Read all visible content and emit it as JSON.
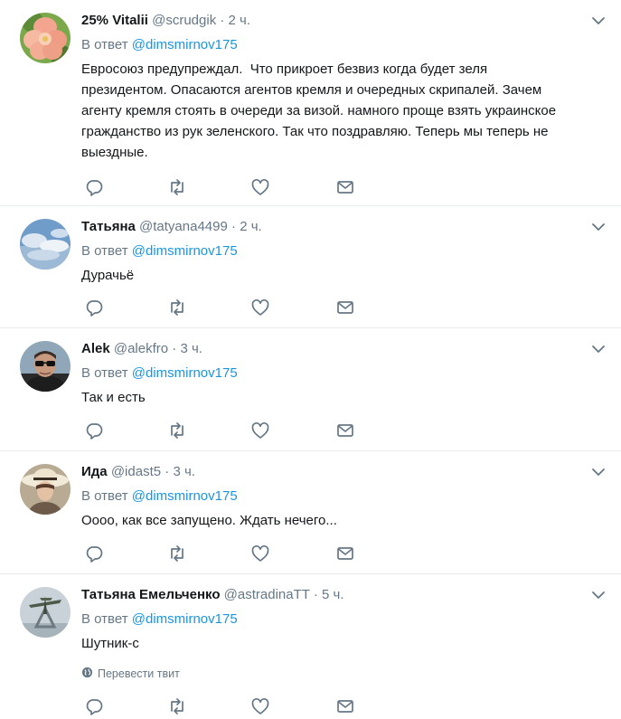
{
  "reply_prefix": "В ответ",
  "tweets": [
    {
      "name": "25% Vitalii",
      "handle": "@scrudgik",
      "time": "2 ч.",
      "reply_to": "@dimsmirnov175",
      "text": "Евросоюз предупреждал.  Что прикроет безвиз когда будет зеля\nпрезидентом. Опасаются агентов кремля и очередных скрипалей. Зачем\nагенту кремля стоять в очереди за визой. намного проще взять украинское\nгражданство из рук зеленского. Так что поздравляю. Теперь мы теперь не\nвыездные."
    },
    {
      "name": "Татьяна",
      "handle": "@tatyana4499",
      "time": "2 ч.",
      "reply_to": "@dimsmirnov175",
      "text": "Дурачьё"
    },
    {
      "name": "Alek",
      "handle": "@alekfro",
      "time": "3 ч.",
      "reply_to": "@dimsmirnov175",
      "text": "Так и есть"
    },
    {
      "name": "Ида",
      "handle": "@idast5",
      "time": "3 ч.",
      "reply_to": "@dimsmirnov175",
      "text": "Оооо, как все запущено. Ждать нечего..."
    },
    {
      "name": "Татьяна Емельченко",
      "handle": "@astradinaTT",
      "time": "5 ч.",
      "reply_to": "@dimsmirnov175",
      "text": "Шутник-с",
      "translate": "Перевести твит"
    }
  ],
  "icons": {
    "reply": "reply-icon",
    "retweet": "retweet-icon",
    "like": "heart-icon",
    "dm": "envelope-icon",
    "caret": "chevron-down-icon",
    "globe": "globe-icon"
  },
  "colors": {
    "link": "#1b95e0",
    "secondary": "#657786",
    "text": "#14171a",
    "divider": "#e6ecf0"
  }
}
